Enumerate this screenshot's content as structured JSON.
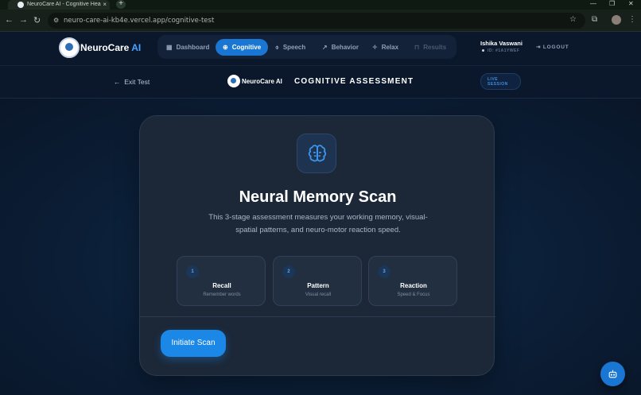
{
  "browser": {
    "tab_title": "NeuroCare AI - Cognitive Hea",
    "tab_close": "×",
    "new_tab": "+",
    "url": "neuro-care-ai-kb4e.vercel.app/cognitive-test",
    "window_minimize": "—",
    "window_restore": "❐",
    "window_close": "✕"
  },
  "header": {
    "brand_main": "NeuroCare",
    "brand_accent": "AI",
    "nav": [
      {
        "label": "Dashboard",
        "icon": "grid-icon",
        "glyph": "▦"
      },
      {
        "label": "Cognitive",
        "icon": "brain-icon",
        "glyph": "⊕",
        "active": true
      },
      {
        "label": "Speech",
        "icon": "mic-icon",
        "glyph": "⌽"
      },
      {
        "label": "Behavior",
        "icon": "trend-icon",
        "glyph": "↗"
      },
      {
        "label": "Relax",
        "icon": "sparkle-icon",
        "glyph": "✧"
      },
      {
        "label": "Results",
        "icon": "lock-icon",
        "glyph": "⊓",
        "disabled": true
      }
    ],
    "user_name": "Ishika Vaswani",
    "user_id": "ID: #1A1YWEF",
    "logout": "LOGOUT"
  },
  "subheader": {
    "exit": "Exit Test",
    "brand": "NeuroCare AI",
    "title": "COGNITIVE ASSESSMENT",
    "badge_line1": "LIVE",
    "badge_line2": "SESSION"
  },
  "card": {
    "title": "Neural Memory Scan",
    "description": "This 3-stage assessment measures your working memory, visual-spatial patterns, and neuro-motor reaction speed.",
    "stages": [
      {
        "num": "1",
        "name": "Recall",
        "sub": "Remember words"
      },
      {
        "num": "2",
        "name": "Pattern",
        "sub": "Visual recall"
      },
      {
        "num": "3",
        "name": "Reaction",
        "sub": "Speed & Focus"
      }
    ],
    "button": "Initiate Scan"
  },
  "colors": {
    "accent": "#1976d2",
    "accent_light": "#4aa3ff",
    "background": "#0a1528",
    "card": "#1c2838"
  }
}
